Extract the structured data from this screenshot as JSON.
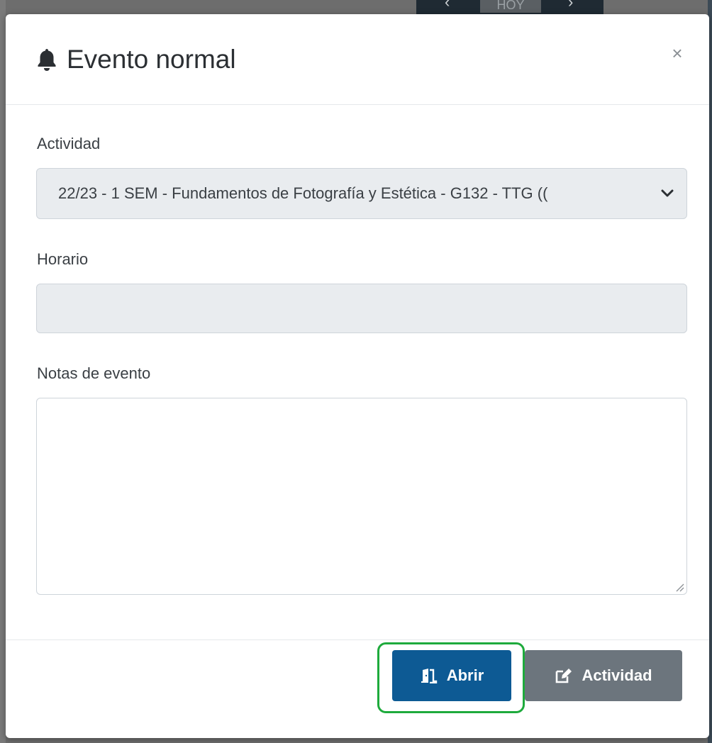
{
  "background": {
    "nav_prev": "‹",
    "nav_today": "HOY",
    "nav_next": "›"
  },
  "modal": {
    "title": "Evento normal",
    "close_label": "×",
    "fields": {
      "actividad": {
        "label": "Actividad",
        "selected_value": "22/23 - 1 SEM - Fundamentos de Fotografía y Estética - G132 - TTG (("
      },
      "horario": {
        "label": "Horario",
        "value": ""
      },
      "notas": {
        "label": "Notas de evento",
        "value": ""
      }
    },
    "footer": {
      "abrir_label": "Abrir",
      "actividad_label": "Actividad"
    }
  },
  "colors": {
    "primary_button": "#0d5a94",
    "secondary_button": "#6c757d",
    "highlight_outline": "#1eaa3c"
  },
  "icons": {
    "title": "bell-icon",
    "close": "close-icon",
    "select": "chevron-down-icon",
    "abrir": "door-open-icon",
    "actividad": "edit-icon"
  }
}
